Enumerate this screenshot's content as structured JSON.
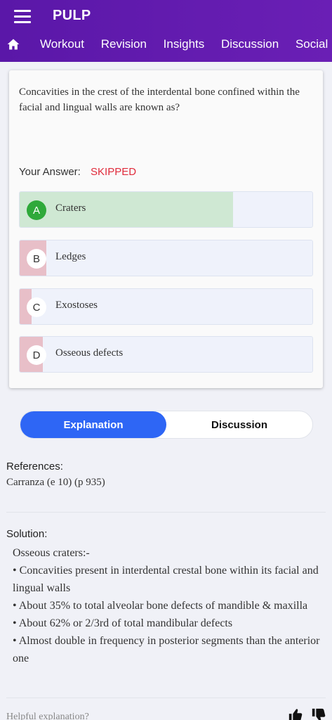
{
  "app": {
    "title": "PULP"
  },
  "nav": {
    "tabs": [
      {
        "label": "Workout"
      },
      {
        "label": "Revision"
      },
      {
        "label": "Insights"
      },
      {
        "label": "Discussion"
      },
      {
        "label": "Social"
      }
    ]
  },
  "question": {
    "text": "Concavities in the crest of the interdental bone confined within the facial and lingual walls are known as?",
    "your_answer_label": "Your Answer:",
    "your_answer_value": "SKIPPED"
  },
  "options": [
    {
      "letter": "A",
      "label": "Craters",
      "percent": 0.73,
      "correct": true
    },
    {
      "letter": "B",
      "label": "Ledges",
      "percent": 0.09,
      "correct": false
    },
    {
      "letter": "C",
      "label": "Exostoses",
      "percent": 0.04,
      "correct": false
    },
    {
      "letter": "D",
      "label": "Osseous defects",
      "percent": 0.08,
      "correct": false
    }
  ],
  "toggle": {
    "explanation": "Explanation",
    "discussion": "Discussion"
  },
  "references": {
    "heading": "References:",
    "text": "Carranza (e 10) (p 935)"
  },
  "solution": {
    "heading": "Solution:",
    "intro": "Osseous craters:-",
    "bullets": [
      "•  Concavities present in interdental crestal bone within its facial and lingual walls",
      "•  About 35% to total alveolar bone defects of mandible & maxilla",
      "•  About 62% or 2/3rd of total mandibular defects",
      "•  Almost double in frequency in posterior segments than the anterior one"
    ]
  },
  "feedback": {
    "prompt": "Helpful explanation?"
  },
  "colors": {
    "header": "#6a1fb5",
    "correct": "#2fa93a",
    "correct_fill": "#cfe8d3",
    "wrong_fill": "#e8bfc8",
    "skipped": "#e02b3b",
    "accent": "#2e66f5"
  }
}
